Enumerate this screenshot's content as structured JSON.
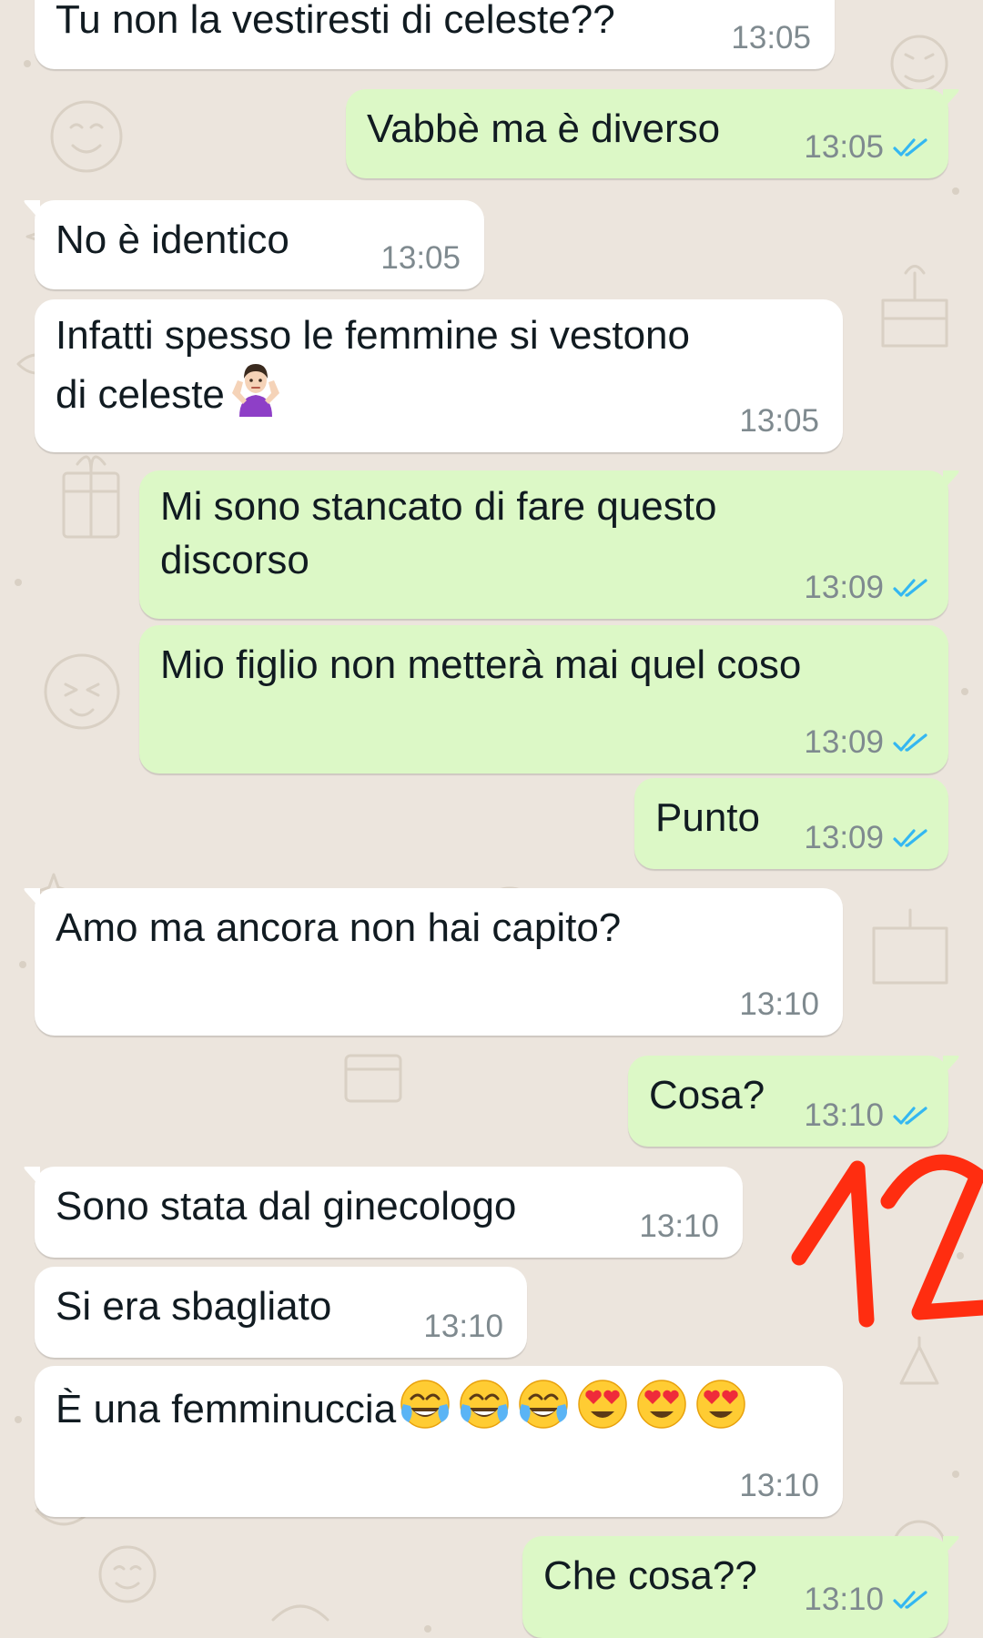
{
  "colors": {
    "incoming_bubble": "#ffffff",
    "outgoing_bubble": "#dcf8c6",
    "read_ticks": "#34b7f1",
    "timestamp": "#7f8a8f",
    "wallpaper": "#ece5dd",
    "annotation": "#ff2d10"
  },
  "messages": [
    {
      "text": "Tu non la vestiresti di celeste??",
      "time": "13:05"
    },
    {
      "text": "Vabbè ma è diverso",
      "time": "13:05",
      "status": "read-ticks-icon"
    },
    {
      "text": "No è identico",
      "time": "13:05"
    },
    {
      "line1": "Infatti spesso le femmine si vestono",
      "line2": "di celeste",
      "emoji": "shrugging-woman-emoji",
      "time": "13:05"
    },
    {
      "line1": "Mi sono stancato di fare questo",
      "line2": "discorso",
      "time": "13:09",
      "status": "read-ticks-icon"
    },
    {
      "text": "Mio figlio non metterà mai quel coso",
      "time": "13:09",
      "status": "read-ticks-icon"
    },
    {
      "text": "Punto",
      "time": "13:09",
      "status": "read-ticks-icon"
    },
    {
      "text": "Amo ma ancora non hai capito?",
      "time": "13:10"
    },
    {
      "text": "Cosa?",
      "time": "13:10",
      "status": "read-ticks-icon"
    },
    {
      "text": "Sono stata dal ginecologo",
      "time": "13:10"
    },
    {
      "text": "Si era sbagliato",
      "time": "13:10"
    },
    {
      "text": "È una femminuccia",
      "emojis": [
        "tears-of-joy-emoji",
        "tears-of-joy-emoji",
        "tears-of-joy-emoji",
        "heart-eyes-emoji",
        "heart-eyes-emoji",
        "heart-eyes-emoji"
      ],
      "time": "13:10"
    },
    {
      "text": "Che cosa??",
      "time": "13:10",
      "status": "read-ticks-icon"
    }
  ],
  "annotation": {
    "text": "12"
  }
}
